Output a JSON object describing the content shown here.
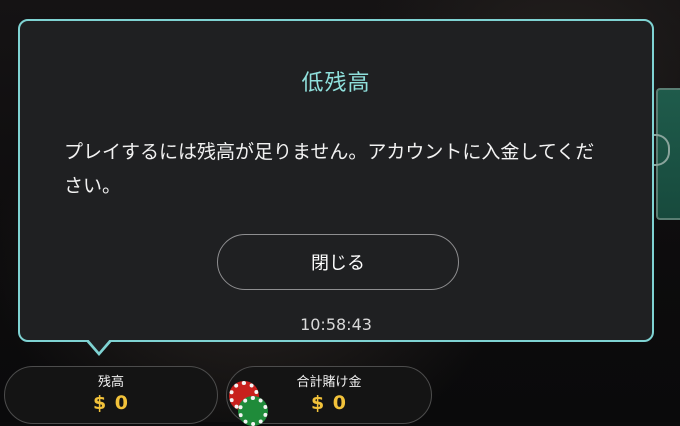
{
  "modal": {
    "title": "低残高",
    "message": "プレイするには残高が足りません。アカウントに入金してください。",
    "close_label": "閉じる",
    "time": "10:58:43"
  },
  "footer": {
    "balance_label": "残高",
    "balance_value": "$ 0",
    "total_bet_label": "合計賭け金",
    "total_bet_value": "$ 0"
  },
  "colors": {
    "modal_border": "#7fd3d3",
    "title": "#8fe0dc",
    "amount": "#f2c23a"
  }
}
